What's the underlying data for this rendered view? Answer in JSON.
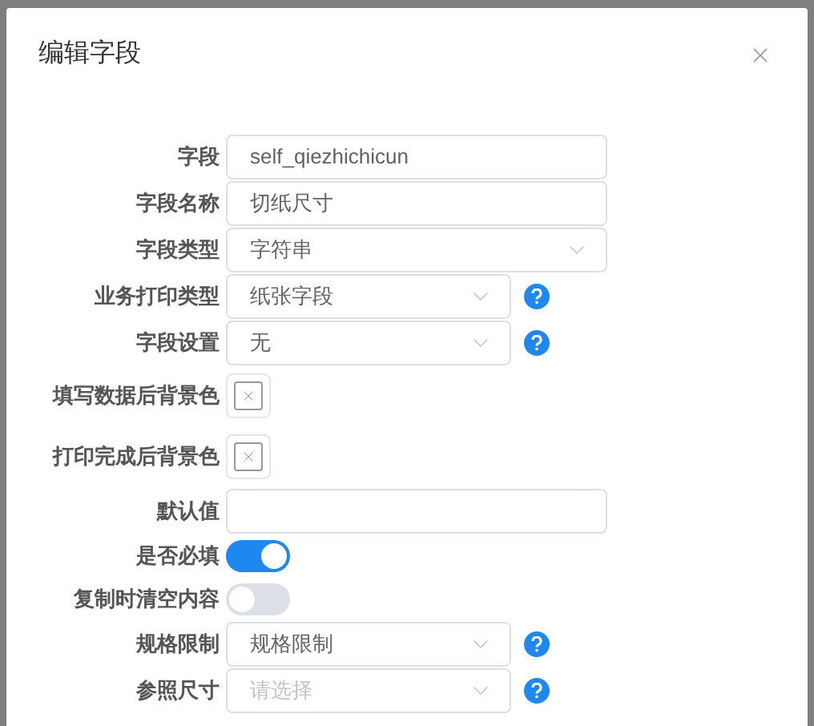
{
  "dialog": {
    "title": "编辑字段"
  },
  "fields": [
    {
      "label": "字段",
      "kind": "text",
      "value": "self_qiezhichicun"
    },
    {
      "label": "字段名称",
      "kind": "text",
      "value": "切纸尺寸"
    },
    {
      "label": "字段类型",
      "kind": "select",
      "value": "字符串",
      "help": false
    },
    {
      "label": "业务打印类型",
      "kind": "select",
      "value": "纸张字段",
      "help": true
    },
    {
      "label": "字段设置",
      "kind": "select",
      "value": "无",
      "help": true
    },
    {
      "label": "填写数据后背景色",
      "kind": "color"
    },
    {
      "label": "打印完成后背景色",
      "kind": "color"
    },
    {
      "label": "默认值",
      "kind": "text"
    },
    {
      "label": "是否必填",
      "kind": "switch",
      "on": true
    },
    {
      "label": "复制时清空内容",
      "kind": "switch",
      "on": false
    },
    {
      "label": "规格限制",
      "kind": "select",
      "value": "规格限制",
      "help": true
    },
    {
      "label": "参照尺寸",
      "kind": "select",
      "placeholder": "请选择",
      "help": true
    }
  ]
}
